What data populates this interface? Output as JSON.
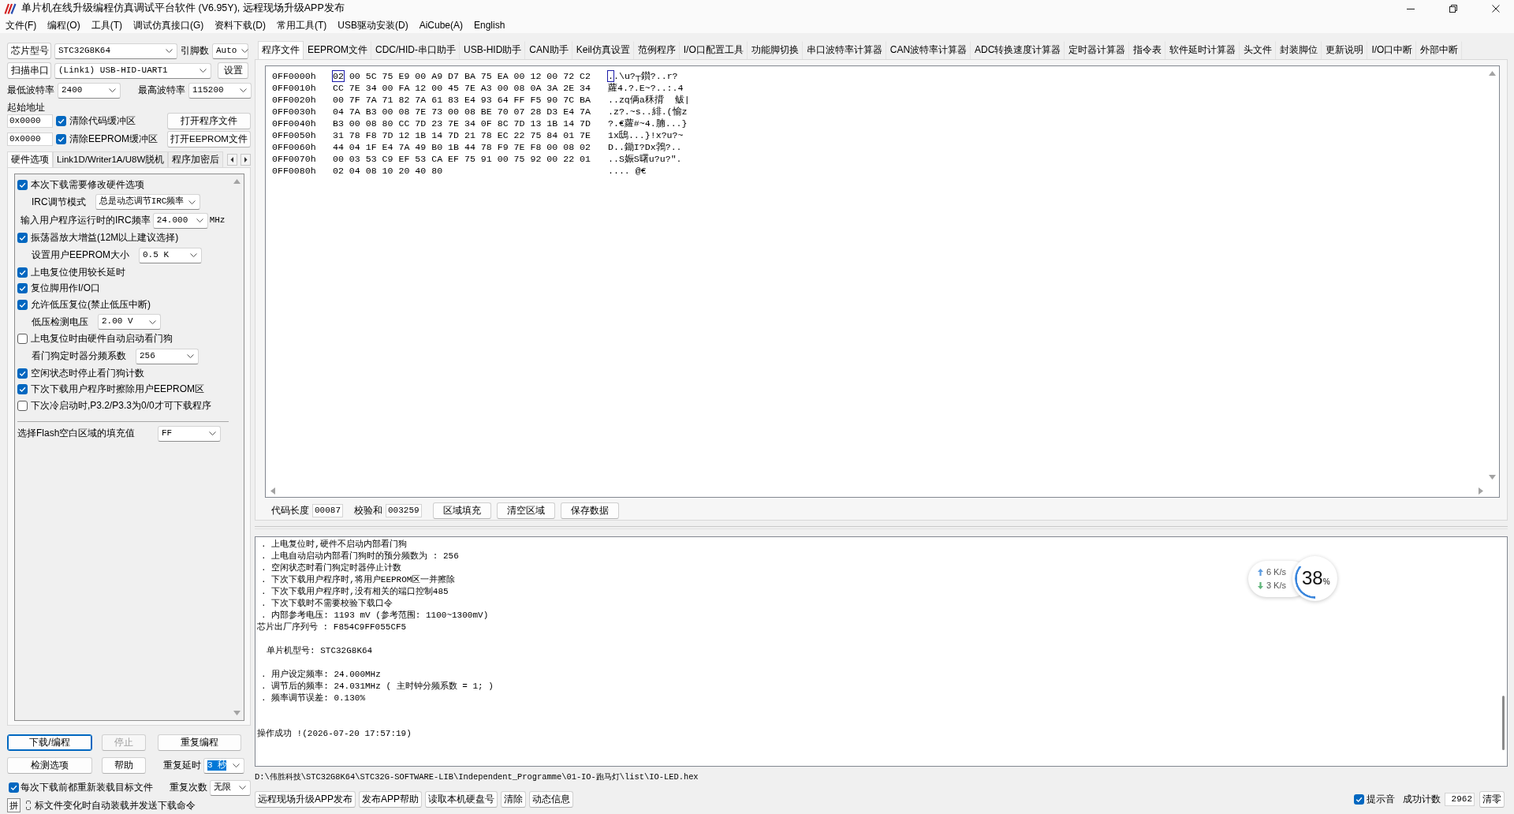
{
  "window": {
    "title": "单片机在线升级编程仿真调试平台软件 (V6.95Y), 远程现场升级APP发布"
  },
  "menu": [
    "文件(F)",
    "编程(O)",
    "工具(T)",
    "调试仿真接口(G)",
    "资料下载(D)",
    "常用工具(T)",
    "USB驱动安装(D)",
    "AiCube(A)",
    "English"
  ],
  "chip_row": {
    "button": "芯片型号",
    "chip": "STC32G8K64",
    "pins_label": "引脚数",
    "pins": "Auto"
  },
  "port_row": {
    "button": "扫描串口",
    "port": "(Link1) USB-HID-UART1",
    "settings_button": "设置"
  },
  "baud_row": {
    "min_label": "最低波特率",
    "min": "2400",
    "max_label": "最高波特率",
    "max": "115200"
  },
  "start_address": {
    "label": "起始地址",
    "rows": [
      {
        "address": "0x0000",
        "clear_label": "清除代码缓冲区",
        "checked": true,
        "open_button": "打开程序文件"
      },
      {
        "address": "0x0000",
        "clear_label": "清除EEPROM缓冲区",
        "checked": true,
        "open_button": "打开EEPROM文件"
      }
    ]
  },
  "option_tabs": [
    {
      "label": "硬件选项",
      "selected": true
    },
    {
      "label": "Link1D/Writer1A/U8W脱机",
      "selected": false
    },
    {
      "label": "程序加密后",
      "selected": false
    }
  ],
  "options": [
    {
      "kind": "checkbox",
      "label": "本次下载需要修改硬件选项",
      "checked": true
    },
    {
      "kind": "select",
      "label": "IRC调节模式",
      "value": "总是动态调节IRC频率"
    },
    {
      "kind": "frequency",
      "label": "输入用户程序运行时的IRC频率",
      "value": "24.000",
      "unit": "MHz"
    },
    {
      "kind": "checkbox",
      "label": "振荡器放大增益(12M以上建议选择)",
      "checked": true
    },
    {
      "kind": "select",
      "label": "设置用户EEPROM大小",
      "value": "0.5 K"
    },
    {
      "kind": "checkbox",
      "label": "上电复位使用较长延时",
      "checked": true
    },
    {
      "kind": "checkbox",
      "label": "复位脚用作I/O口",
      "checked": true
    },
    {
      "kind": "checkbox",
      "label": "允许低压复位(禁止低压中断)",
      "checked": true
    },
    {
      "kind": "select",
      "label": "低压检测电压",
      "value": "2.00 V"
    },
    {
      "kind": "checkbox",
      "label": "上电复位时由硬件自动启动看门狗",
      "checked": false
    },
    {
      "kind": "select",
      "label": "看门狗定时器分频系数",
      "value": "256"
    },
    {
      "kind": "checkbox",
      "label": "空闲状态时停止看门狗计数",
      "checked": true
    },
    {
      "kind": "checkbox",
      "label": "下次下载用户程序时擦除用户EEPROM区",
      "checked": true
    },
    {
      "kind": "checkbox",
      "label": "下次冷启动时,P3.2/P3.3为0/0才可下载程序",
      "checked": false
    }
  ],
  "fill_option": {
    "label": "选择Flash空白区域的填充值",
    "value": "FF"
  },
  "actions": [
    {
      "label": "下载/编程",
      "focused": true,
      "disabled": false
    },
    {
      "label": "停止",
      "focused": false,
      "disabled": true
    },
    {
      "label": "重复编程",
      "focused": false,
      "disabled": false
    },
    {
      "label": "检测选项",
      "focused": false,
      "disabled": false
    },
    {
      "label": "帮助",
      "focused": false,
      "disabled": false
    }
  ],
  "repeat_delay": {
    "label": "重复延时",
    "value": "3 秒",
    "highlighted": true
  },
  "repeat_count": {
    "label": "重复次数",
    "value": "无限"
  },
  "reload_option": {
    "label": "每次下载前都重新装载目标文件",
    "checked": true
  },
  "ime_indicator": "拼",
  "auto_option_label": "标文件变化时自动装载并发送下载命令",
  "file_tabs": [
    {
      "label": "程序文件",
      "selected": true
    },
    {
      "label": "EEPROM文件",
      "selected": false
    },
    {
      "label": "CDC/HID-串口助手",
      "selected": false
    },
    {
      "label": "USB-HID助手",
      "selected": false
    },
    {
      "label": "CAN助手",
      "selected": false
    },
    {
      "label": "Keil仿真设置",
      "selected": false
    },
    {
      "label": "范例程序",
      "selected": false
    },
    {
      "label": "I/O口配置工具",
      "selected": false
    },
    {
      "label": "功能脚切换",
      "selected": false
    },
    {
      "label": "串口波特率计算器",
      "selected": false
    },
    {
      "label": "CAN波特率计算器",
      "selected": false
    },
    {
      "label": "ADC转换速度计算器",
      "selected": false
    },
    {
      "label": "定时器计算器",
      "selected": false
    },
    {
      "label": "指令表",
      "selected": false
    },
    {
      "label": "软件延时计算器",
      "selected": false
    },
    {
      "label": "头文件",
      "selected": false
    },
    {
      "label": "封装脚位",
      "selected": false
    },
    {
      "label": "更新说明",
      "selected": false
    },
    {
      "label": "I/O口中断",
      "selected": false
    },
    {
      "label": "外部中断",
      "selected": false
    }
  ],
  "hex_view": {
    "rows": [
      {
        "address": "0FF0000h",
        "bytes": "02 00 5C 75 E9 00 A9 D7 BA 75 EA 00 12 00 72 C2",
        "ascii": "..\\u?┬鑚?..r?",
        "cursor": true
      },
      {
        "address": "0FF0010h",
        "bytes": "CC 7E 34 00 FA 12 00 45 7E A3 00 08 0A 3A 2E 34",
        "ascii": "蘿4.?.E~?..:.4",
        "cursor": false
      },
      {
        "address": "0FF0020h",
        "bytes": "00 7F 7A 71 82 7A 61 83 E4 93 64 FF F5 90 7C BA",
        "ascii": "..zq俩a秝揹  鲅|",
        "cursor": false
      },
      {
        "address": "0FF0030h",
        "bytes": "04 7A B3 00 08 7E 73 00 08 BE 70 07 28 D3 E4 7A",
        "ascii": ".z?.~s..緋.(愉z",
        "cursor": false
      },
      {
        "address": "0FF0040h",
        "bytes": "B3 00 08 80 CC 7D 23 7E 34 0F 8C 7D 13 1B 14 7D",
        "ascii": "?.€蘿#~4.腩...}",
        "cursor": false
      },
      {
        "address": "0FF0050h",
        "bytes": "31 78 F8 7D 12 1B 14 7D 21 78 EC 22 75 84 01 7E",
        "ascii": "1x鴟...}!x?u?~",
        "cursor": false
      },
      {
        "address": "0FF0060h",
        "bytes": "44 04 1F E4 7A 49 B0 1B 44 78 F9 7E F8 00 08 02",
        "ascii": "D..鋤I?Dx鵓?..",
        "cursor": false
      },
      {
        "address": "0FF0070h",
        "bytes": "00 03 53 C9 EF 53 CA EF 75 91 00 75 92 00 22 01",
        "ascii": "..S娠S曙u?u?\".",
        "cursor": false
      },
      {
        "address": "0FF0080h",
        "bytes": "02 04 08 10 20 40 80",
        "ascii": ".... @€",
        "cursor": false
      }
    ]
  },
  "buffer_info": {
    "length_label": "代码长度",
    "length": "00087",
    "checksum_label": "校验和",
    "checksum": "003259",
    "buttons": [
      "区域填充",
      "清空区域",
      "保存数据"
    ]
  },
  "log": {
    "blocks": [
      {
        "kind": "info",
        "lines": [
          {
            "text": ". 上电复位时,硬件不启动内部看门狗",
            "kind": "bullet"
          },
          {
            "text": ". 上电自动启动内部看门狗时的预分频数为 : 256",
            "kind": "bullet"
          },
          {
            "text": ". 空闲状态时看门狗定时器停止计数",
            "kind": "bullet"
          },
          {
            "text": ". 下次下载用户程序时,将用户EEPROM区一并擦除",
            "kind": "bullet"
          },
          {
            "text": ". 下次下载用户程序时,没有相关的端口控制485",
            "kind": "bullet"
          },
          {
            "text": ". 下次下载时不需要校验下载口令",
            "kind": "bullet"
          },
          {
            "text": ". 内部参考电压: 1193 mV (参考范围: 1100~1300mV)",
            "kind": "bullet"
          },
          {
            "text": "芯片出厂序列号 : F854C9FF055CF5",
            "kind": "plain"
          }
        ]
      },
      {
        "kind": "info",
        "lines": [
          {
            "text": "单片机型号: STC32G8K64",
            "kind": "sub"
          }
        ]
      },
      {
        "kind": "info",
        "lines": [
          {
            "text": ". 用户设定频率: 24.000MHz",
            "kind": "bullet"
          },
          {
            "text": ". 调节后的频率: 24.031MHz ( 主时钟分频系数 = 1; )",
            "kind": "bullet"
          },
          {
            "text": ". 频率调节误差: 0.130%",
            "kind": "bullet"
          }
        ]
      },
      {
        "kind": "status",
        "lines": [
          {
            "text": "操作成功 !(2026-07-20 17:57:19)",
            "kind": "plain"
          }
        ]
      }
    ]
  },
  "network_meter": {
    "upload": "6 K/s",
    "download": "3 K/s",
    "percent": "38$_{%}$"
  },
  "file_path": "D:\\伟胜科技\\STC32G8K64\\STC32G-SOFTWARE-LIB\\Independent_Programme\\01-IO-跑马灯\\list\\IO-LED.hex",
  "bottom_buttons": [
    "远程现场升级APP发布",
    "发布APP帮助",
    "读取本机硬盘号",
    "清除",
    "动态信息"
  ],
  "sound_option": {
    "label": "提示音",
    "checked": true
  },
  "success_count": {
    "label": "成功计数",
    "value": "2962",
    "reset_button": "清零"
  }
}
